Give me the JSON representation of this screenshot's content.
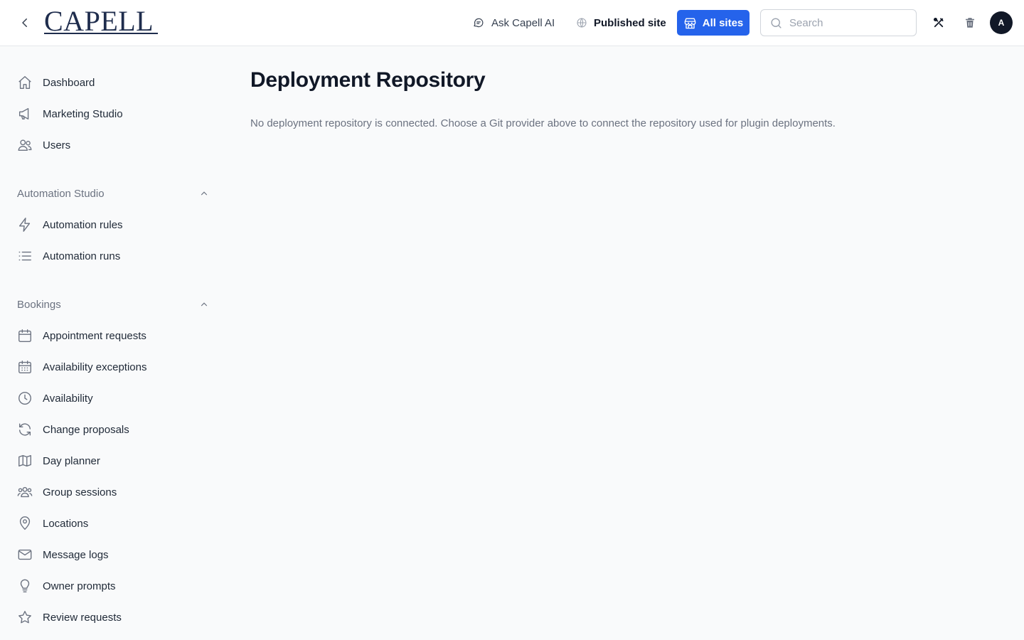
{
  "header": {
    "logo_text": "CAPELL",
    "ask_ai_label": "Ask Capell AI",
    "published_label": "Published site",
    "all_sites_label": "All sites",
    "search_placeholder": "Search",
    "avatar_initial": "A"
  },
  "sidebar": {
    "top_items": [
      {
        "label": "Dashboard",
        "icon": "home-icon"
      },
      {
        "label": "Marketing Studio",
        "icon": "megaphone-icon"
      },
      {
        "label": "Users",
        "icon": "users-icon"
      }
    ],
    "sections": [
      {
        "title": "Automation Studio",
        "items": [
          {
            "label": "Automation rules",
            "icon": "bolt-icon"
          },
          {
            "label": "Automation runs",
            "icon": "list-icon"
          }
        ]
      },
      {
        "title": "Bookings",
        "items": [
          {
            "label": "Appointment requests",
            "icon": "calendar-icon"
          },
          {
            "label": "Availability exceptions",
            "icon": "calendar-days-icon"
          },
          {
            "label": "Availability",
            "icon": "clock-icon"
          },
          {
            "label": "Change proposals",
            "icon": "refresh-icon"
          },
          {
            "label": "Day planner",
            "icon": "map-icon"
          },
          {
            "label": "Group sessions",
            "icon": "user-group-icon"
          },
          {
            "label": "Locations",
            "icon": "map-pin-icon"
          },
          {
            "label": "Message logs",
            "icon": "envelope-icon"
          },
          {
            "label": "Owner prompts",
            "icon": "light-bulb-icon"
          },
          {
            "label": "Review requests",
            "icon": "star-icon"
          }
        ]
      }
    ]
  },
  "main": {
    "title": "Deployment Repository",
    "description": "No deployment repository is connected. Choose a Git provider above to connect the repository used for plugin deployments."
  },
  "colors": {
    "accent": "#2563eb",
    "background": "#f9fafb",
    "text": "#111827",
    "muted": "#6b7280"
  }
}
